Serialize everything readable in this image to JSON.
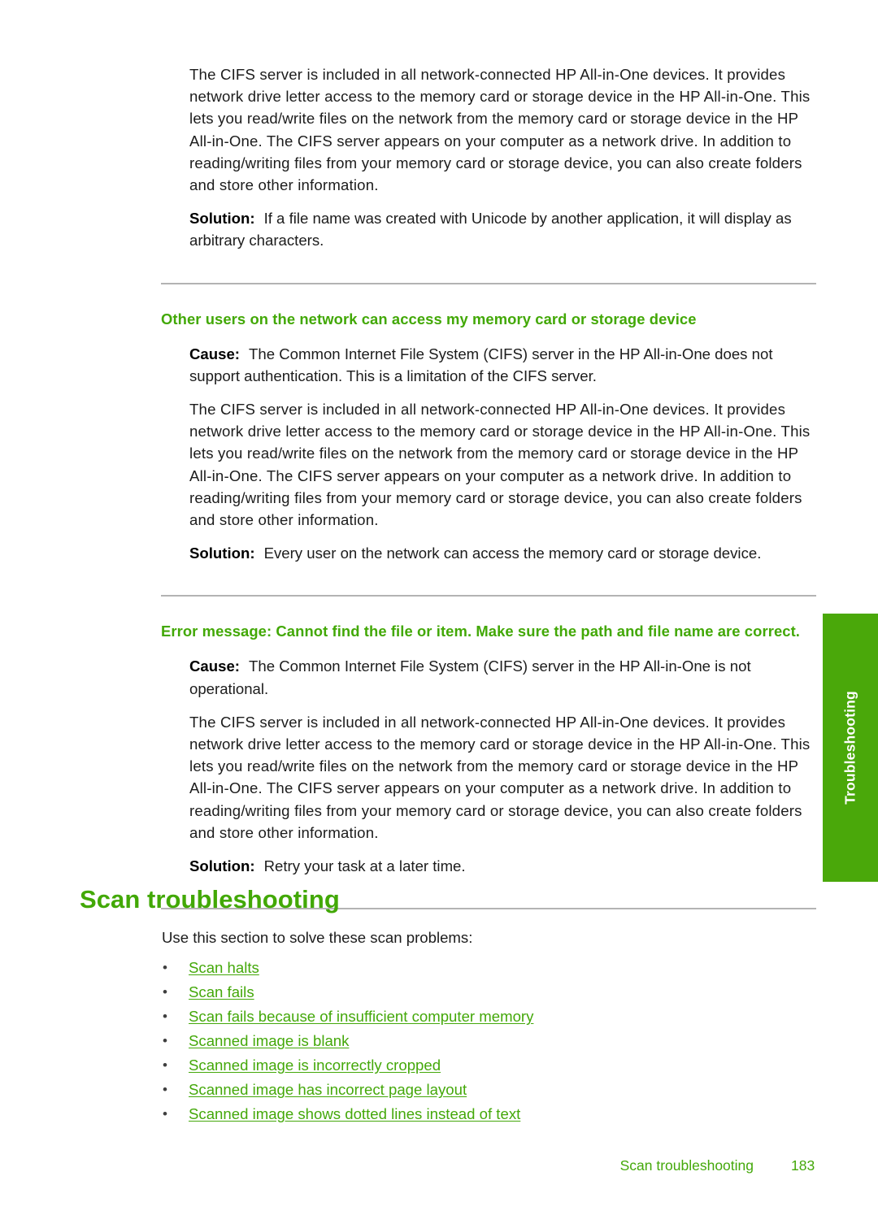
{
  "document": {
    "shared_paragraph": "The CIFS server is included in all network-connected HP All-in-One devices. It provides network drive letter access to the memory card or storage device in the HP All-in-One. This lets you read/write files on the network from the memory card or storage device in the HP All-in-One. The CIFS server appears on your computer as a network drive. In addition to reading/writing files from your memory card or storage device, you can also create folders and store other information.",
    "cause_label": "Cause:",
    "solution_label": "Solution:"
  },
  "sections": [
    {
      "solution_text": "If a file name was created with Unicode by another application, it will display as arbitrary characters."
    },
    {
      "heading": "Other users on the network can access my memory card or storage device",
      "cause_text": "The Common Internet File System (CIFS) server in the HP All-in-One does not support authentication. This is a limitation of the CIFS server.",
      "solution_text": "Every user on the network can access the memory card or storage device."
    },
    {
      "heading": "Error message: Cannot find the file or item. Make sure the path and file name are correct.",
      "cause_text": "The Common Internet File System (CIFS) server in the HP All-in-One is not operational.",
      "solution_text": "Retry your task at a later time."
    }
  ],
  "chapter": {
    "title": "Scan troubleshooting",
    "intro": "Use this section to solve these scan problems:",
    "links": [
      "Scan halts",
      "Scan fails",
      "Scan fails because of insufficient computer memory",
      "Scanned image is blank",
      "Scanned image is incorrectly cropped",
      "Scanned image has incorrect page layout",
      "Scanned image shows dotted lines instead of text"
    ]
  },
  "side_tab": {
    "label": "Troubleshooting"
  },
  "footer": {
    "title": "Scan troubleshooting",
    "page_number": "183"
  },
  "bullet_glyph": "•",
  "colors": {
    "heading_green": "#42a806",
    "link_green": "#44a80a",
    "tab_green": "#4aa80a",
    "rule_gray": "#b3b3b3",
    "body_text": "#1c1c1c"
  }
}
